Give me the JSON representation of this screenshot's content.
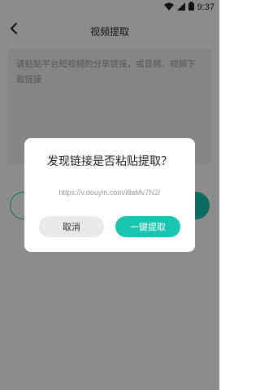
{
  "status_bar": {
    "time": "9:37",
    "wifi_icon": "wifi-icon",
    "signal_icon": "signal-icon",
    "battery_icon": "battery-icon"
  },
  "header": {
    "title": "视频提取",
    "back_icon": "chevron-left-icon"
  },
  "input": {
    "placeholder": "请粘贴平台短视频的分享链接，或音频、视频下载链接"
  },
  "background_buttons": {
    "left_label": "",
    "right_label": ""
  },
  "dialog": {
    "title": "发现链接是否粘贴提取？",
    "url": "https://v.douyin.com/i8aMv7N2/",
    "cancel_label": "取消",
    "confirm_label": "一键提取"
  },
  "colors": {
    "accent": "#19c4b0",
    "overlay": "rgba(0,0,0,0.45)",
    "text": "#222222",
    "muted": "#9a9a9a"
  }
}
